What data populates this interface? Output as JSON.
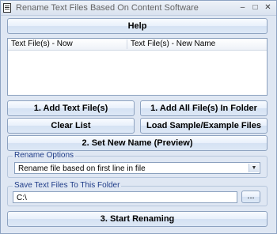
{
  "window": {
    "title": "Rename Text Files Based On Content Software",
    "minimize_glyph": "–",
    "maximize_glyph": "□",
    "close_glyph": "✕",
    "icon": "document-icon"
  },
  "toolbar": {
    "help_label": "Help"
  },
  "file_list": {
    "columns": [
      "Text File(s) - Now",
      "Text File(s) - New Name"
    ],
    "rows": []
  },
  "buttons": {
    "add_files": "1. Add Text File(s)",
    "add_folder": "1. Add All File(s) In Folder",
    "clear_list": "Clear List",
    "load_sample": "Load Sample/Example Files",
    "set_new_name": "2. Set New Name (Preview)",
    "browse": "...",
    "start_renaming": "3. Start Renaming"
  },
  "rename_options": {
    "label": "Rename Options",
    "selected": "Rename file based on first line in file",
    "arrow_glyph": "▼"
  },
  "save_folder": {
    "label": "Save Text Files To This Folder",
    "value": "C:\\"
  },
  "colors": {
    "background": "#dfe7f3",
    "group_label": "#1f3c88",
    "button_border": "#8da2c0"
  }
}
